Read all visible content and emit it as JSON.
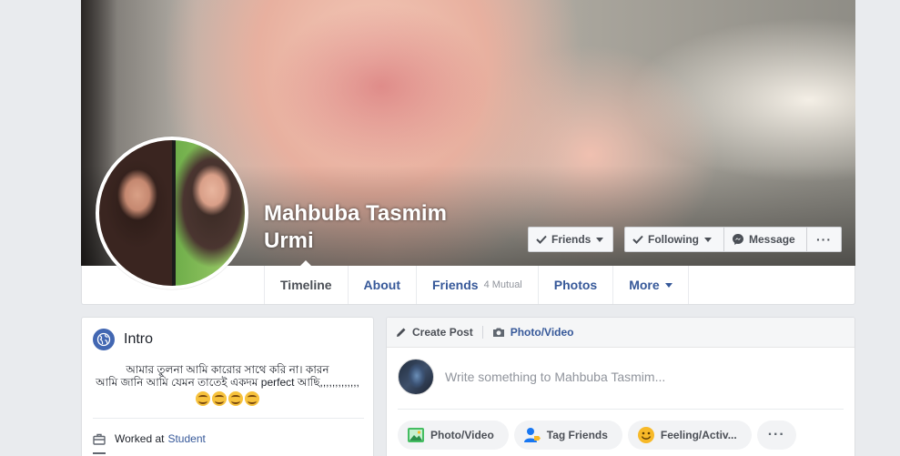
{
  "profile": {
    "name": "Mahbuba Tasmim Urmi"
  },
  "cover_actions": {
    "friends_label": "Friends",
    "following_label": "Following",
    "message_label": "Message",
    "more_label": "···"
  },
  "tabs": [
    {
      "label": "Timeline",
      "active": true
    },
    {
      "label": "About"
    },
    {
      "label": "Friends",
      "sub": "4 Mutual"
    },
    {
      "label": "Photos"
    },
    {
      "label": "More"
    }
  ],
  "intro": {
    "title": "Intro",
    "bio_line1": "আমার তুলনা আমি কারোর সাথে করি না। কারন",
    "bio_line2": "আমি জানি আমি যেমন তাতেই একদম perfect আছি,,,,,,,,,,,,,",
    "work_prefix": "Worked at",
    "work_place": "Student"
  },
  "composer": {
    "create_post_label": "Create Post",
    "photo_video_label": "Photo/Video",
    "placeholder": "Write something to Mahbuba Tasmim...",
    "actions": [
      {
        "label": "Photo/Video"
      },
      {
        "label": "Tag Friends"
      },
      {
        "label": "Feeling/Activ..."
      },
      {
        "label": "···"
      }
    ]
  },
  "colors": {
    "link_blue": "#365899",
    "fb_blue": "#4267b2",
    "page_bg": "#e9ebee"
  }
}
